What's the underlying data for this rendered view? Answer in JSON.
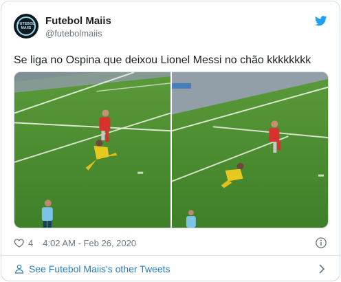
{
  "tweet": {
    "display_name": "Futebol Maiis",
    "handle": "@futebolmaiis",
    "avatar_text": "FUTEBOL MAIIS",
    "text": "Se liga no Ospina que deixou Lionel Messi no chão kkkkkkkk",
    "likes": "4",
    "timestamp": "4:02 AM - Feb 26, 2020",
    "footer_link": "See Futebol Maiis's other Tweets"
  },
  "icons": {
    "brand": "twitter-bird-icon",
    "like": "heart-icon",
    "info": "info-icon",
    "profile": "person-icon",
    "more": "chevron-right-icon"
  },
  "colors": {
    "brand_blue": "#1da1f2",
    "link_blue": "#2b7bb9",
    "muted_text": "#697882",
    "pitch_green": "#4d8a32"
  },
  "media": [
    {
      "description": "photo-1"
    },
    {
      "description": "photo-2"
    }
  ]
}
